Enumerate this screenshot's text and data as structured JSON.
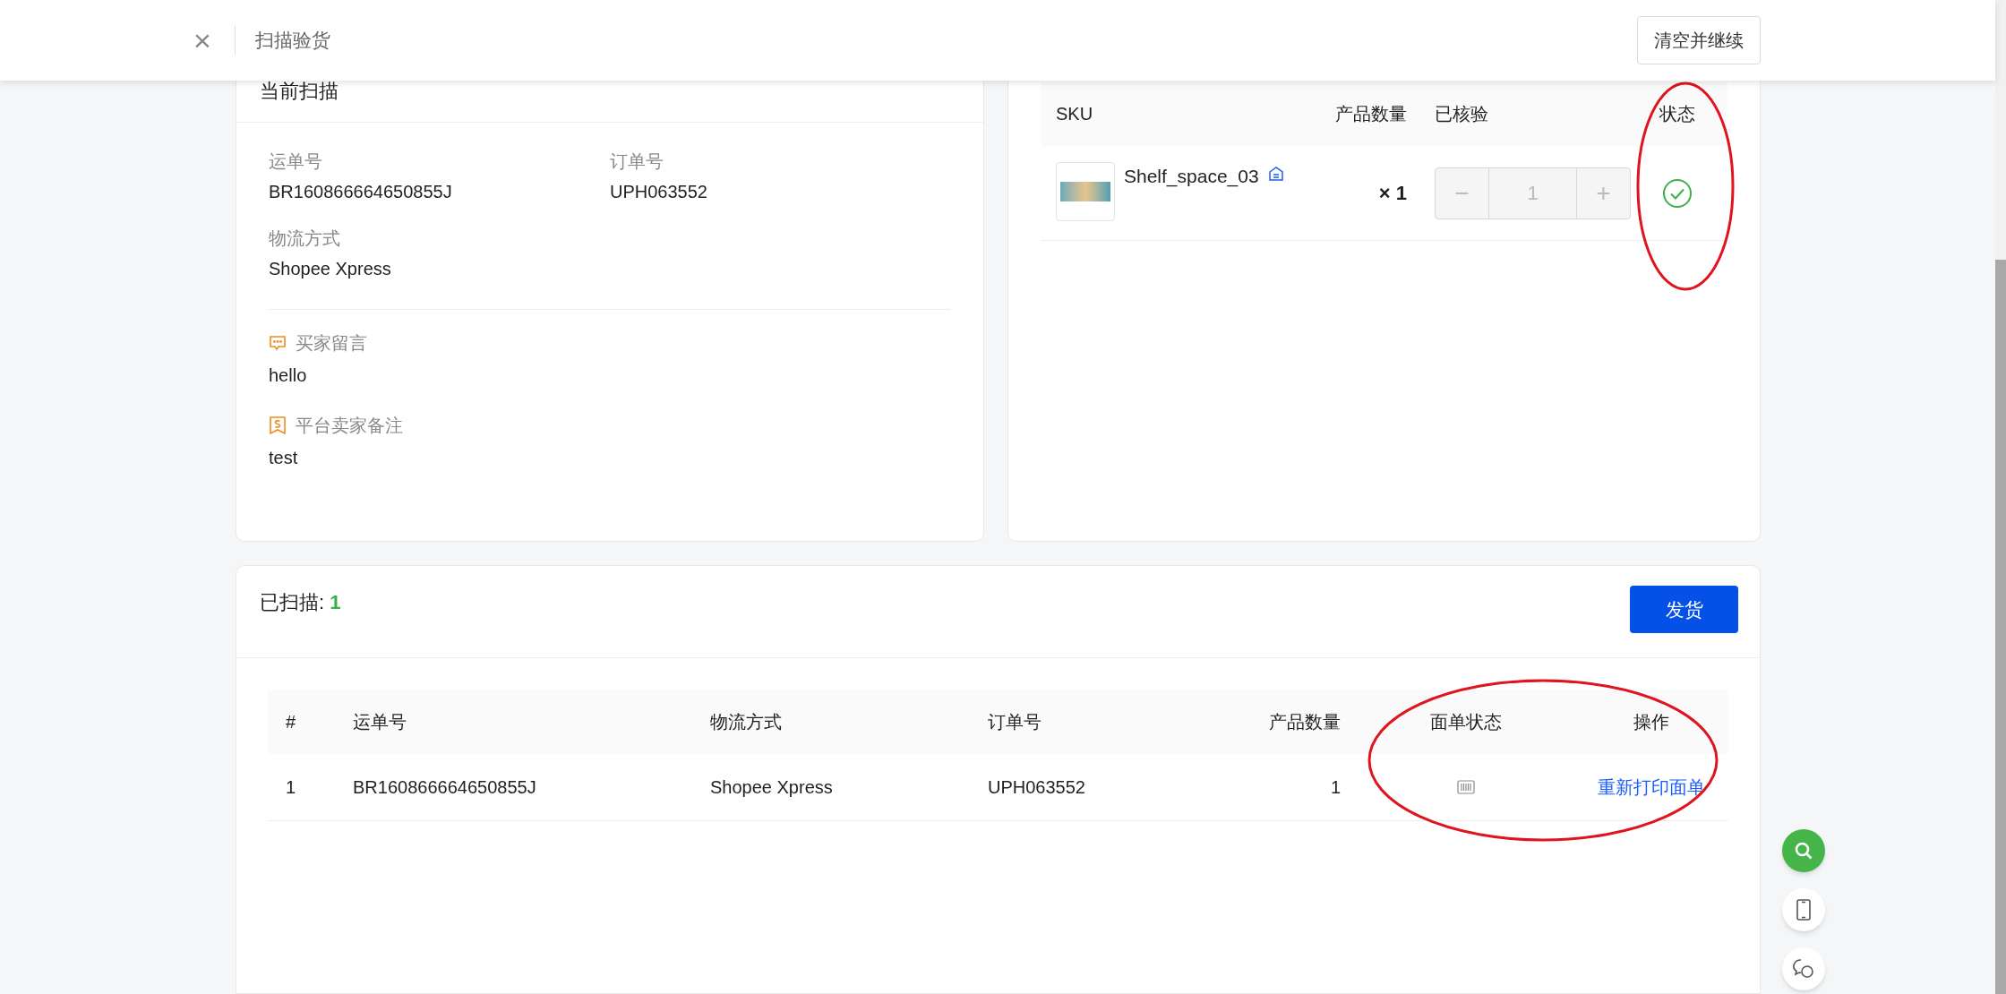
{
  "header": {
    "close": "×",
    "title": "扫描验货",
    "clear_button": "清空并继续"
  },
  "current_scan": {
    "title": "当前扫描",
    "fields": [
      {
        "label": "运单号",
        "value": "BR160866664650855J"
      },
      {
        "label": "订单号",
        "value": "UPH063552"
      },
      {
        "label": "物流方式",
        "value": "Shopee Xpress"
      }
    ],
    "notes": [
      {
        "kind": "message",
        "label": "买家留言",
        "value": "hello"
      },
      {
        "kind": "seller",
        "label": "平台卖家备注",
        "value": "test"
      }
    ]
  },
  "sku_table": {
    "columns": [
      "SKU",
      "产品数量",
      "已核验",
      "状态"
    ],
    "rows": [
      {
        "sku": "Shelf_space_03",
        "quantity": "× 1",
        "minus": "−",
        "verified": "1",
        "plus": "+",
        "checked": true
      }
    ]
  },
  "scanned": {
    "label": "已扫描:",
    "count": "1",
    "ship_button": "发货",
    "columns": [
      "#",
      "运单号",
      "物流方式",
      "订单号",
      "产品数量",
      "面单状态",
      "操作"
    ],
    "rows": [
      {
        "index": "1",
        "tracking": "BR160866664650855J",
        "shipping": "Shopee Xpress",
        "order": "UPH063552",
        "quantity": "1",
        "action": "重新打印面单"
      }
    ]
  }
}
